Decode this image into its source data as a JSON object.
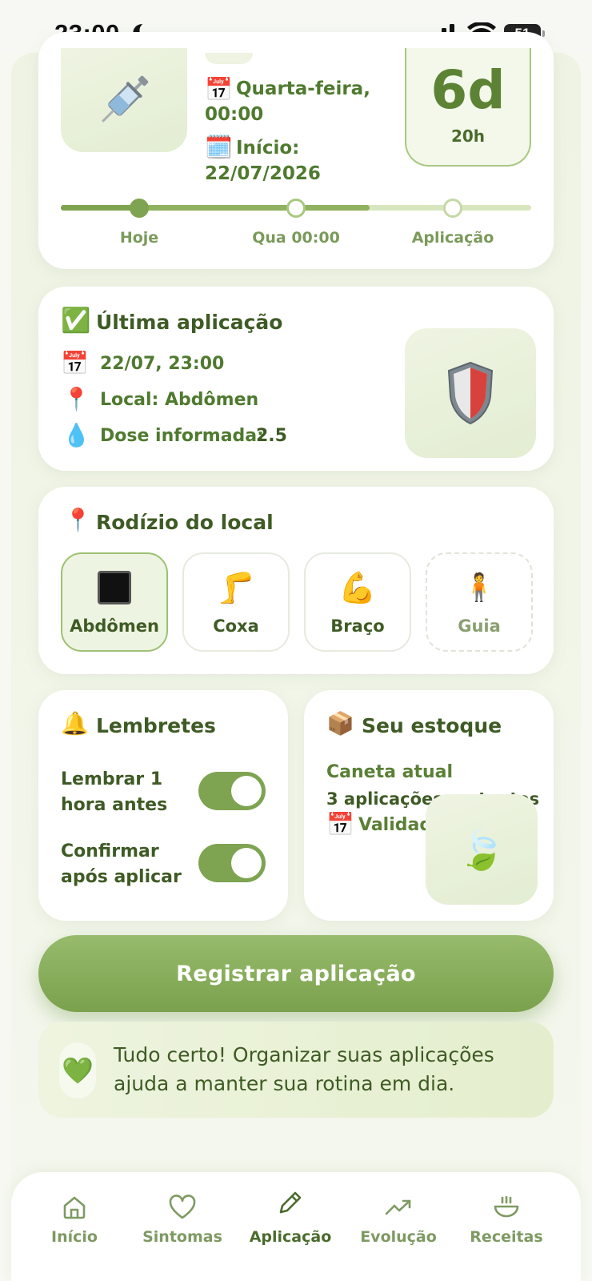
{
  "status_bar": {
    "time": "23:00",
    "battery": "51"
  },
  "next_dose": {
    "partial_top_text": "",
    "weekday": "Quarta-feira,",
    "time": "00:00",
    "start_label": "Início:",
    "start_date": "22/07/2026",
    "countdown_days": "6d",
    "countdown_hours": "20h",
    "progress": 0.66,
    "steps": [
      "Hoje",
      "Qua 00:00",
      "Aplicação"
    ]
  },
  "last_application": {
    "title": "Última aplicação",
    "date": "22/07, 23:00",
    "location": "Local: Abdômen",
    "dose_label": "Dose informada:",
    "dose_value": "2.5"
  },
  "rotation": {
    "title": "Rodízio do local",
    "sites": [
      {
        "label": "Abdômen",
        "icon": "black-square-icon"
      },
      {
        "label": "Coxa",
        "icon": "leg-icon"
      },
      {
        "label": "Braço",
        "icon": "flexed-biceps-icon"
      },
      {
        "label": "Guia",
        "icon": "person-standing-icon"
      }
    ]
  },
  "reminders": {
    "title": "Lembretes",
    "item1": "Lembrar 1 hora antes",
    "item2": "Confirmar após aplicar",
    "item1_on": true,
    "item2_on": true
  },
  "stock": {
    "title": "Seu estoque",
    "current": "Caneta atual",
    "remaining": "3 aplicações restantes",
    "validity": "Validade"
  },
  "cta": {
    "label": "Registrar aplicação"
  },
  "banner": {
    "text": "Tudo certo! Organizar suas aplicações ajuda a manter sua rotina em dia."
  },
  "nav": [
    {
      "label": "Início",
      "icon": "home-icon"
    },
    {
      "label": "Sintomas",
      "icon": "heart-icon"
    },
    {
      "label": "Aplicação",
      "icon": "pencil-icon"
    },
    {
      "label": "Evolução",
      "icon": "trend-up-icon"
    },
    {
      "label": "Receitas",
      "icon": "bowl-icon"
    }
  ],
  "colors": {
    "accent": "#7ea451",
    "text": "#3f5b25",
    "background": "#eef3e3"
  }
}
